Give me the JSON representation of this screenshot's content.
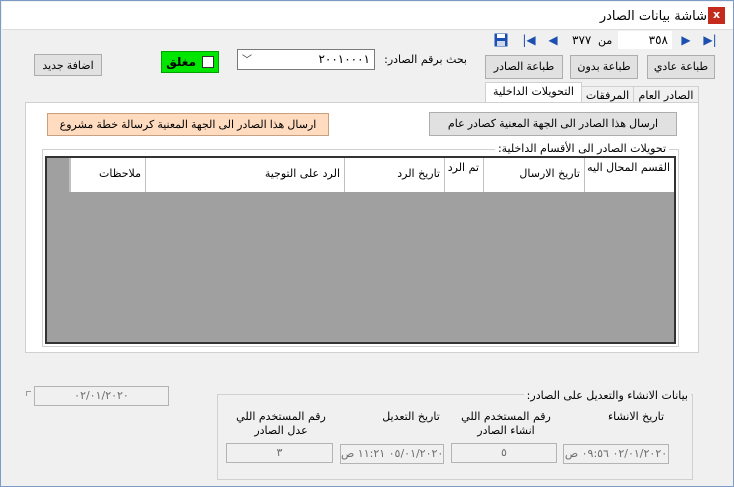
{
  "window": {
    "title": "شاشة بيانات الصادر"
  },
  "navigator": {
    "current": "٣٥٨",
    "of_label": "من",
    "total": "٣٧٧"
  },
  "toolbar": {
    "print_normal": "طباعة عادي",
    "print_without": "طباعة بدون",
    "print_outgoing": "طباعة الصادر",
    "add_new": "اضافة جديد"
  },
  "search": {
    "label": "بحث برقم الصادر:",
    "value": "٢٠٠١٠٠٠١"
  },
  "closed": {
    "label": "مغلق",
    "checked": false
  },
  "tabs": [
    {
      "label": "الصادر العام",
      "active": false
    },
    {
      "label": "المرفقات",
      "active": false
    },
    {
      "label": "التحويلات الداخلية",
      "active": true
    }
  ],
  "internal": {
    "send_general": "ارسال هذا الصادر الى الجهة المعنية كصادر عام",
    "send_project": "ارسال هذا الصادر الى الجهة المعنية كرسالة خطة مشروع",
    "group_title": "تحويلات الصادر الى الأقسام الداخلية:",
    "columns": [
      "القسم المحال اليه",
      "تاريخ الارسال",
      "تم الرد",
      "تاريخ الرد",
      "الرد على التوجية",
      "ملاحظات"
    ]
  },
  "left_date": "٠٢/٠١/٢٠٢٠",
  "audit": {
    "title": "بيانات الانشاء والتعديل على الصادر:",
    "created_date_label": "تاريخ الانشاء",
    "created_date_value": "٠٢/٠١/٢٠٢٠ ٠٩:٥٦ ص",
    "creator_label": "رقم المستخدم اللي انشاء الصادر",
    "creator_value": "٥",
    "modified_date_label": "تاريخ التعديل",
    "modified_date_value": "٠٥/٠١/٢٠٢٠ ١١:٢١ ص",
    "modifier_label": "رقم المستخدم اللي عدل الصادر",
    "modifier_value": "٣"
  },
  "colors": {
    "closed_bg": "#00e600",
    "orange_btn": "#ffdcc0",
    "nav_blue": "#1c4fb0",
    "close_red": "#c42b1c"
  }
}
